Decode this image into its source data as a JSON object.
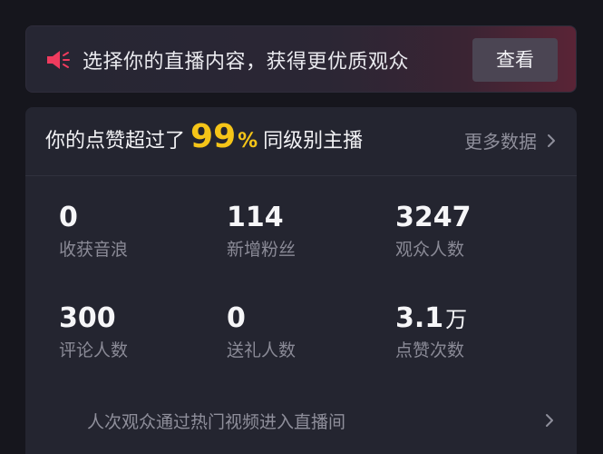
{
  "banner": {
    "icon": "speaker-icon",
    "text": "选择你的直播内容，获得更优质观众",
    "button_label": "查看",
    "accent": "#e0335a"
  },
  "summary": {
    "prefix": "你的点赞超过了",
    "percent_value": "99",
    "percent_sign": "%",
    "suffix": "同级别主播",
    "more_label": "更多数据",
    "highlight_color": "#f5c518"
  },
  "stats": [
    {
      "value": "0",
      "unit": "",
      "label": "收获音浪"
    },
    {
      "value": "114",
      "unit": "",
      "label": "新增粉丝"
    },
    {
      "value": "3247",
      "unit": "",
      "label": "观众人数"
    },
    {
      "value": "300",
      "unit": "",
      "label": "评论人数"
    },
    {
      "value": "0",
      "unit": "",
      "label": "送礼人数"
    },
    {
      "value": "3.1",
      "unit": "万",
      "label": "点赞次数"
    }
  ],
  "footer": {
    "text": "人次观众通过热门视频进入直播间"
  }
}
